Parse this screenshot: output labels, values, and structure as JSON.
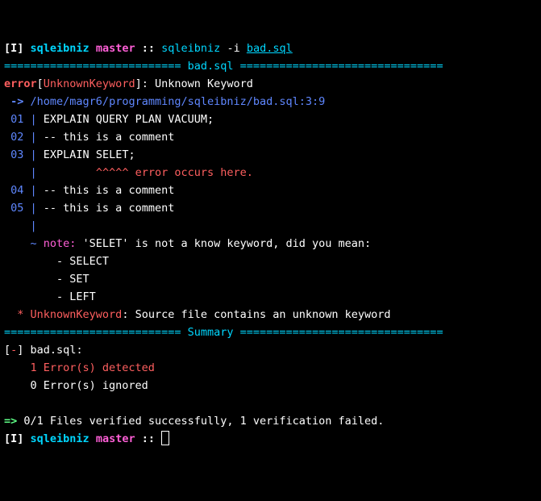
{
  "prompt1": {
    "mode": "[I]",
    "dir": "sqleibniz",
    "branch": "master",
    "sep": "::",
    "cmd": "sqleibniz",
    "flag": "-i",
    "arg": "bad.sql"
  },
  "hr_left": "===========================",
  "hr_file": " bad.sql ",
  "hr_right": "===============================",
  "err_label": "error",
  "err_lbracket": "[",
  "err_code": "UnknownKeyword",
  "err_rbracket": "]: ",
  "err_msg": "Unknown Keyword",
  "arrow": " ->",
  "path": "/home/magr6/programming/sqleibniz/bad.sql:3:9",
  "l01_num": " 01",
  "l01_pipe": " | ",
  "l01_text": "EXPLAIN QUERY PLAN VACUUM;",
  "l02_num": " 02",
  "l02_pipe": " | ",
  "l02_text": "-- this is a comment",
  "l03_num": " 03",
  "l03_pipe": " | ",
  "l03_text_pre": "EXPLAIN ",
  "l03_text_err": "SELET",
  "l03_text_post": ";",
  "caret_pad": "   ",
  "caret_pipe": " |",
  "caret_space": "         ",
  "caret_marks": "^^^^^",
  "caret_msg": " error occurs here.",
  "l04_num": " 04",
  "l04_pipe": " | ",
  "l04_text": "-- this is a comment",
  "l05_num": " 05",
  "l05_pipe": " | ",
  "l05_text": "-- this is a comment",
  "blank_pad": "   ",
  "blank_pipe": " |",
  "note_pad": "   ",
  "note_tilde": " ~ ",
  "note_label": "note:",
  "note_msg": " 'SELET' is not a know keyword, did you mean:",
  "sug1": "        - SELECT",
  "sug2": "        - SET",
  "sug3": "        - LEFT",
  "star": "  * ",
  "star_code": "UnknownKeyword",
  "star_sep": ": ",
  "star_msg": "Source file contains an unknown keyword",
  "sum_left": "===========================",
  "sum_label": " Summary ",
  "sum_right": "===============================",
  "sumline_pre": "[",
  "sumline_dash": "-",
  "sumline_post": "] ",
  "sumline_file": "bad.sql:",
  "detected": "    1 Error(s) detected",
  "ignored": "    0 Error(s) ignored",
  "blank": "",
  "final_arrow": "=>",
  "final_msg": " 0/1 Files verified successfully, 1 verification failed.",
  "prompt2": {
    "mode": "[I]",
    "dir": "sqleibniz",
    "branch": "master",
    "sep": "::"
  }
}
